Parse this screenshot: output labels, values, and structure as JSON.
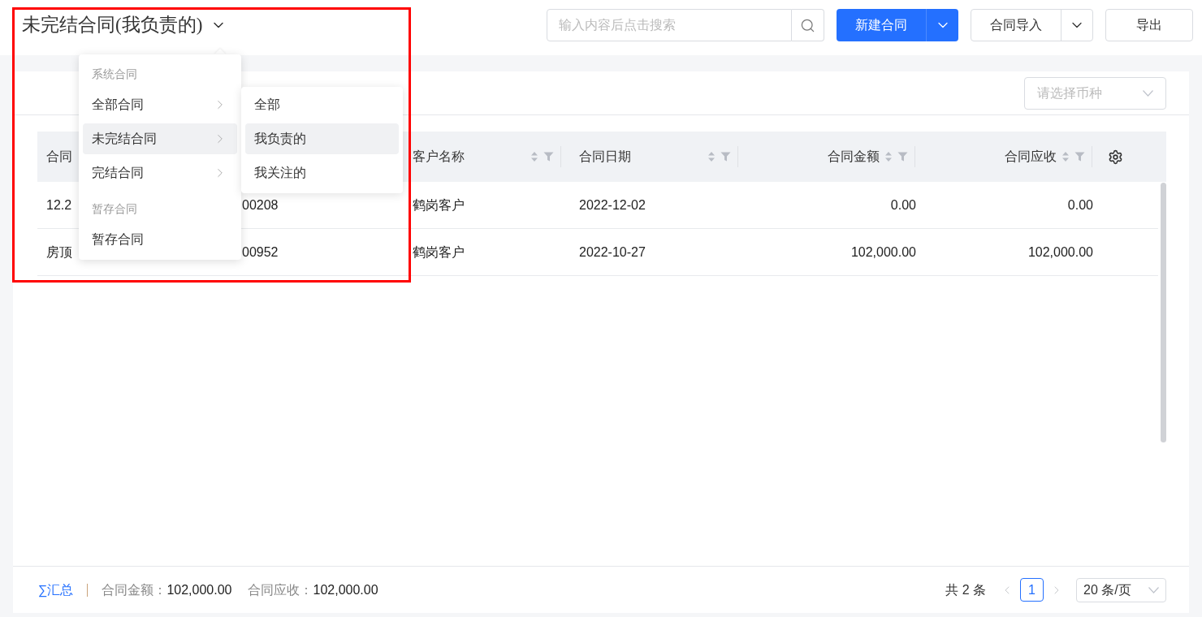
{
  "header": {
    "title": "未完结合同(我负责的)",
    "search": {
      "placeholder": "输入内容后点击搜索"
    },
    "buttons": [
      {
        "label": "新建合同",
        "kind": "primary"
      },
      {
        "label": "合同导入",
        "kind": "split"
      },
      {
        "label": "导出",
        "kind": "plain"
      }
    ]
  },
  "currency_select": {
    "placeholder": "请选择币种"
  },
  "table": {
    "columns": [
      {
        "label": "合同",
        "kind": "text"
      },
      {
        "kind": "text"
      },
      {
        "label": "客户名称",
        "kind": "text",
        "sortable": true
      },
      {
        "label": "合同日期",
        "kind": "text",
        "sortable": true
      },
      {
        "label": "合同金额",
        "kind": "amount",
        "sortable": true
      },
      {
        "label": "合同应收",
        "kind": "amount",
        "sortable": true
      }
    ],
    "rows": [
      [
        "12.2",
        "00208",
        "鹤岗客户",
        "2022-12-02",
        "0.00",
        "0.00"
      ],
      [
        "房顶",
        "00952",
        "鹤岗客户",
        "2022-10-27",
        "102,000.00",
        "102,000.00"
      ]
    ]
  },
  "menu": {
    "groups": [
      {
        "title": "系统合同",
        "items": [
          {
            "label": "全部合同",
            "selected": false,
            "has_submenu": true
          },
          {
            "label": "未完结合同",
            "selected": true,
            "has_submenu": true
          },
          {
            "label": "完结合同",
            "selected": false,
            "has_submenu": true
          }
        ]
      },
      {
        "title": "暂存合同",
        "items": [
          {
            "label": "暂存合同",
            "selected": false,
            "has_submenu": false
          }
        ]
      }
    ],
    "submenu": [
      {
        "label": "全部",
        "selected": false
      },
      {
        "label": "我负责的",
        "selected": true
      },
      {
        "label": "我关注的",
        "selected": false
      }
    ]
  },
  "footer": {
    "summary": {
      "icon": "∑",
      "label": "汇总",
      "items": [
        {
          "label": "合同金额：",
          "value": "102,000.00"
        },
        {
          "label": "合同应收：",
          "value": "102,000.00"
        }
      ]
    },
    "pagination": {
      "total": "共 2 条",
      "prev_disabled": true,
      "next_disabled": true,
      "pages": [
        {
          "label": "1",
          "selected": true
        }
      ],
      "page_size": "20 条/页"
    }
  }
}
